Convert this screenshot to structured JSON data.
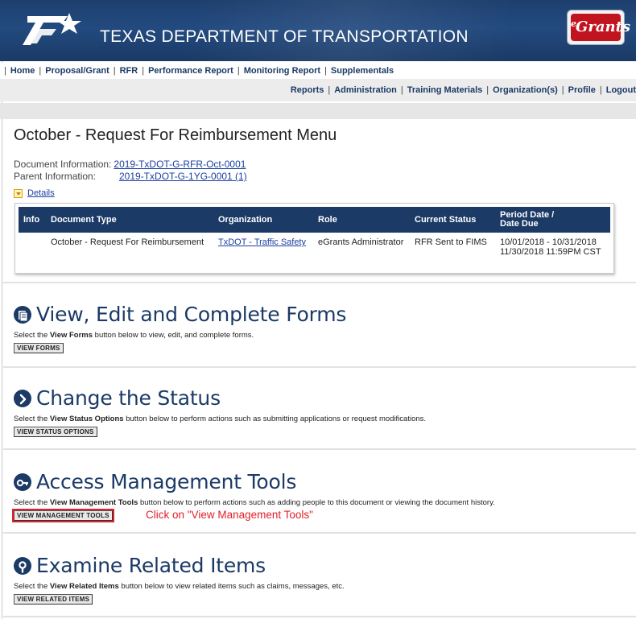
{
  "header": {
    "title": "TEXAS DEPARTMENT OF TRANSPORTATION",
    "logo_icon": "txdot-star-logo-icon",
    "egrants_logo_text": "Grants",
    "egrants_logo_prefix": "e",
    "colors": {
      "header_bg": "#1d3f6e",
      "nav_text": "#1b3a66",
      "egrants_red": "#c2141f"
    }
  },
  "nav_primary": {
    "items": [
      {
        "label": "Home"
      },
      {
        "label": "Proposal/Grant"
      },
      {
        "label": "RFR"
      },
      {
        "label": "Performance Report"
      },
      {
        "label": "Monitoring Report"
      },
      {
        "label": "Supplementals"
      }
    ]
  },
  "nav_secondary": {
    "items": [
      {
        "label": "Reports"
      },
      {
        "label": "Administration"
      },
      {
        "label": "Training Materials"
      },
      {
        "label": "Organization(s)"
      },
      {
        "label": "Profile"
      },
      {
        "label": "Logout"
      }
    ]
  },
  "page": {
    "title": "October - Request For Reimbursement Menu",
    "doc_info_label": "Document Information:",
    "doc_info_value": "2019-TxDOT-G-RFR-Oct-0001",
    "parent_info_label": "Parent Information:",
    "parent_info_value": "2019-TxDOT-G-1YG-0001 (1)",
    "details_label": "Details"
  },
  "doc_table": {
    "headers": [
      "Info",
      "Document Type",
      "Organization",
      "Role",
      "Current Status",
      "Period Date /",
      "Date Due"
    ],
    "row": {
      "info": "",
      "document_type": "October - Request For Reimbursement",
      "organization": "TxDOT - Traffic Safety",
      "role": "eGrants Administrator",
      "current_status": "RFR Sent to FIMS",
      "period_date": "10/01/2018 - 10/31/2018",
      "date_due": "11/30/2018 11:59PM CST"
    }
  },
  "sections": [
    {
      "title": "View, Edit and Complete Forms",
      "icon": "forms-icon",
      "desc_pre": "Select the ",
      "desc_bold": "View Forms",
      "desc_post": " button below to view, edit, and complete forms.",
      "button": "VIEW FORMS"
    },
    {
      "title": "Change the Status",
      "icon": "chevron-right-circle-icon",
      "desc_pre": "Select the ",
      "desc_bold": "View Status Options",
      "desc_post": " button below to perform actions such as submitting applications or request modifications.",
      "button": "VIEW STATUS OPTIONS"
    },
    {
      "title": "Access Management Tools",
      "icon": "key-icon",
      "desc_pre": "Select the ",
      "desc_bold": "View Management Tools",
      "desc_post": " button below to perform actions such as adding people to this document or viewing the document history.",
      "button": "VIEW MANAGEMENT TOOLS",
      "callout": "Click on \"View Management Tools\""
    },
    {
      "title": "Examine Related Items",
      "icon": "magnifier-icon",
      "desc_pre": "Select the ",
      "desc_bold": "View Related Items",
      "desc_post": " button below to view related items such as claims, messages, etc.",
      "button": "VIEW RELATED ITEMS"
    }
  ]
}
